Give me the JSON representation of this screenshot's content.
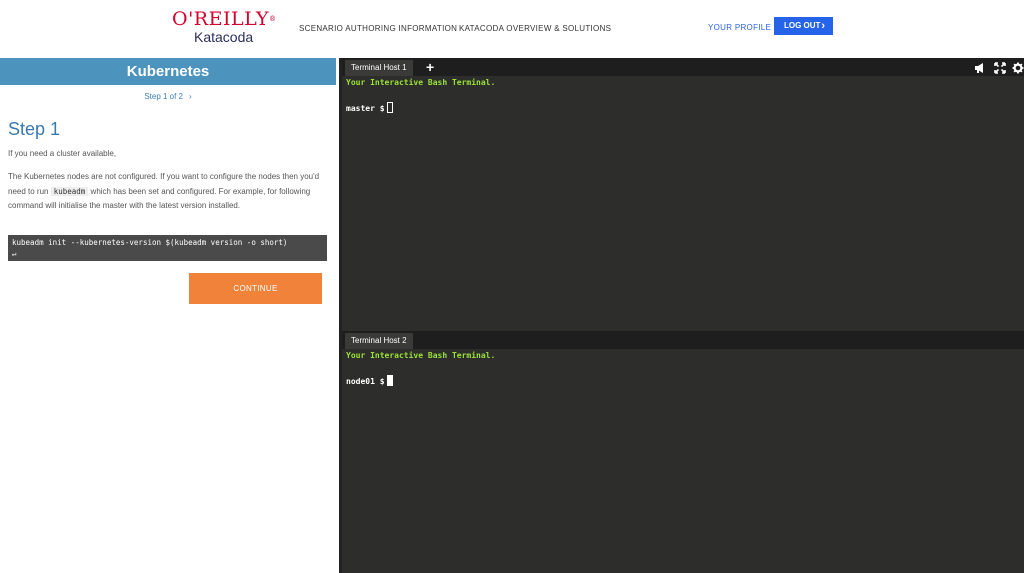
{
  "header": {
    "logo_top": "O'REILLY",
    "logo_bottom": "Katacoda",
    "nav": [
      "SCENARIO AUTHORING INFORMATION",
      "KATACODA OVERVIEW & SOLUTIONS"
    ],
    "profile_label": "YOUR PROFILE",
    "logout_label": "LOG OUT"
  },
  "course": {
    "title": "Kubernetes",
    "step_nav": "Step 1 of 2",
    "step_title": "Step 1",
    "para1": "If you need a cluster available,",
    "para2_a": "The Kubernetes nodes are not configured. If you want to configure the nodes then you'd need to run ",
    "para2_code": "kubeadm",
    "para2_b": " which has been set and configured. For example, for following command will initialise the master with the latest version installed.",
    "command": "kubeadm init --kubernetes-version $(kubeadm version -o short)",
    "command_icon": "↵",
    "continue_label": "CONTINUE"
  },
  "terminals": [
    {
      "tab_label": "Terminal Host 1",
      "welcome": "Your Interactive Bash Terminal.",
      "prompt": "master $"
    },
    {
      "tab_label": "Terminal Host 2",
      "welcome": "Your Interactive Bash Terminal.",
      "prompt": "node01 $"
    }
  ],
  "toolbar_icons": [
    "megaphone-icon",
    "expand-icon",
    "gear-icon"
  ],
  "colors": {
    "accent_blue": "#4c94be",
    "button_orange": "#f08239",
    "logout_blue": "#2563e8",
    "terminal_bg": "#2d2d2b",
    "terminal_green": "#9be336"
  }
}
